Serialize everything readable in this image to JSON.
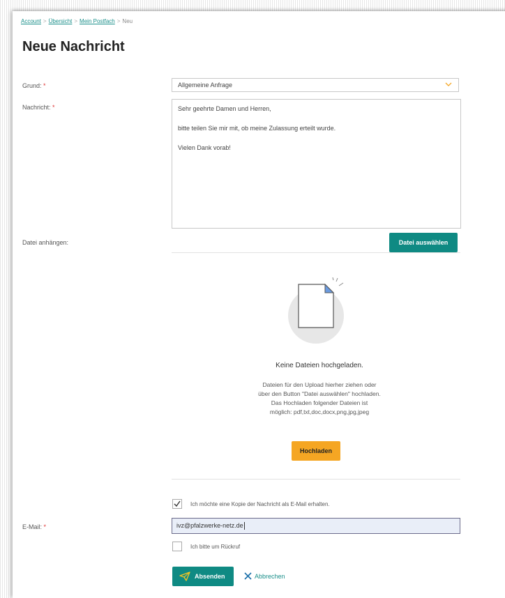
{
  "breadcrumb": {
    "items": [
      "Account",
      "Übersicht",
      "Mein Postfach"
    ],
    "current": "Neu",
    "separator": ">"
  },
  "page_title": "Neue Nachricht",
  "form": {
    "reason_label": "Grund:",
    "reason_value": "Allgemeine Anfrage",
    "message_label": "Nachricht:",
    "message_lines": [
      "Sehr geehrte Damen und Herren,",
      "bitte teilen Sie mir mit, ob meine Zulassung erteilt wurde.",
      "Vielen Dank vorab!"
    ],
    "attach_label": "Datei anhängen:",
    "choose_file_button": "Datei auswählen",
    "no_files_title": "Keine Dateien hochgeladen.",
    "upload_hint_lines": [
      "Dateien für den Upload hierher ziehen oder",
      "über den Button \"Datei auswählen\" hochladen.",
      "Das Hochladen folgender Dateien ist",
      "möglich: pdf,txt,doc,docx,png,jpg,jpeg"
    ],
    "upload_button": "Hochladen",
    "copy_checkbox_label": "Ich möchte eine Kopie der Nachricht als E-Mail erhalten.",
    "copy_checked": true,
    "email_label": "E-Mail:",
    "email_value": "ivz@pfalzwerke-netz.de",
    "callback_checkbox_label": "Ich bitte um Rückruf",
    "callback_checked": false,
    "submit_button": "Absenden",
    "cancel_link": "Abbrechen",
    "required_marker": "*"
  },
  "colors": {
    "accent_teal": "#0f8a83",
    "accent_orange": "#f5a623",
    "required_red": "#dd3333"
  },
  "icons": {
    "select_chevron": "chevron-down-icon",
    "file": "document-icon",
    "submit": "paper-plane-icon",
    "cancel": "close-icon",
    "check": "check-icon"
  }
}
